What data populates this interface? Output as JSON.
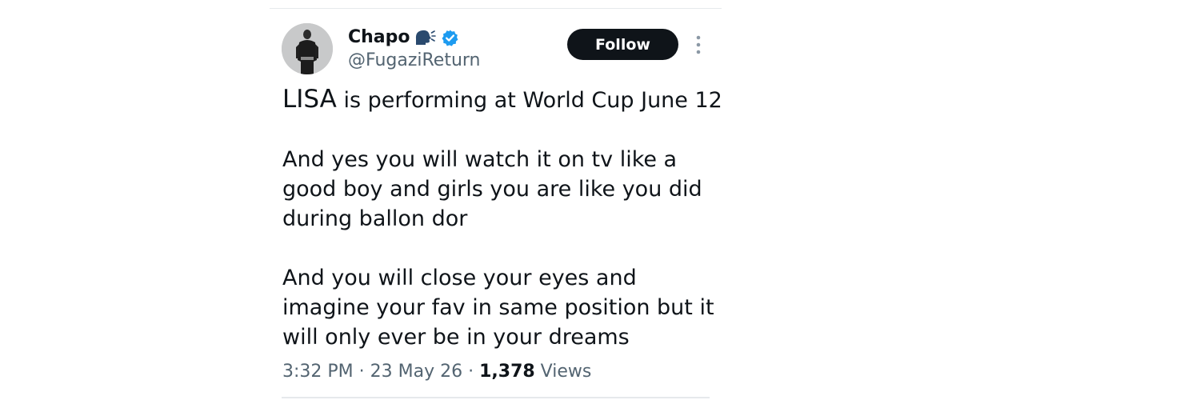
{
  "author": {
    "display_name": "Chapo",
    "handle": "@FugaziReturn",
    "verified": true,
    "accent_color": "#1d9bf0"
  },
  "actions": {
    "follow_label": "Follow"
  },
  "tweet": {
    "lisa": "LISA",
    "line1_rest": " is performing at World Cup June 12",
    "para2": [
      "And yes you will watch it on tv like a",
      "good boy and girls you are like you did",
      "during ballon dor"
    ],
    "para3": [
      "And you will close your eyes and",
      "imagine your fav in same position but it",
      "will only ever be in your dreams"
    ]
  },
  "meta": {
    "time": "3:32 PM",
    "separator1": " · ",
    "date": "23 May 26",
    "separator2": " · ",
    "views_count": "1,378",
    "views_label": " Views"
  },
  "icons": {
    "speaking_head": "speaking-head-emoji",
    "verified_badge": "verified-badge-icon",
    "more": "more-options-icon"
  }
}
